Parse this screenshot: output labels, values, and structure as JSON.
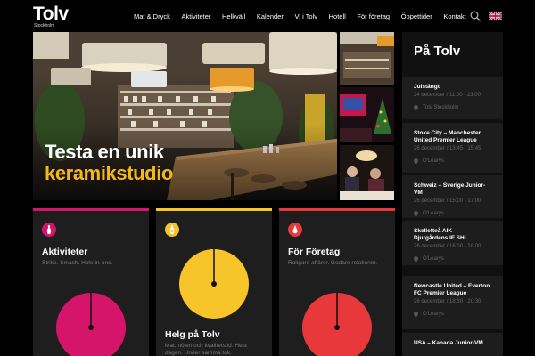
{
  "header": {
    "logo_text": "Tolv",
    "logo_subtext": "Stockholm",
    "nav": [
      "Mat & Dryck",
      "Aktiviteter",
      "Helkväll",
      "Kalender",
      "Vi i Tolv",
      "Hotell",
      "För företag",
      "Öppettider",
      "Kontakt"
    ]
  },
  "hero": {
    "headline_line1": "Testa en unik",
    "headline_line2": "keramikstudio",
    "accent_color": "#f2b71a"
  },
  "cards": [
    {
      "title": "Aktiviteter",
      "description": "Strike. Smash. Hole-in-one.",
      "color": "#d5156a",
      "icon": "bowling-pin-icon"
    },
    {
      "title": "Helg på Tolv",
      "description": "Mat, nöjen och kvalitetstid. Hela dagen. Under samma tak.",
      "color": "#f7c52a",
      "icon": "bottle-icon"
    },
    {
      "title": "För Företag",
      "description": "Roligare affärer. Godare relationer.",
      "color": "#e8383b",
      "icon": "drop-icon"
    }
  ],
  "sidebar": {
    "title": "På Tolv",
    "events": [
      {
        "title": "Julstängt",
        "date": "24 december / 11:00 - 23:00",
        "location": "Tolv Stockholm"
      },
      {
        "title": "Stoke City – Manchester United Premier League",
        "date": "26 december / 13:45 - 15:45",
        "location": "O'Learys"
      },
      {
        "title": "Schweiz – Sverige Junior-VM",
        "date": "26 december / 15:00 - 17:00",
        "location": "O'Learys"
      },
      {
        "title": "Skellefteå AIK – Djurgårdens IF SHL",
        "date": "26 december / 16:00 - 18:00",
        "location": "O'Learys"
      },
      {
        "title": "Newcastle United – Everton FC Premier League",
        "date": "26 december / 18:30 - 20:30",
        "location": "O'Learys"
      },
      {
        "title": "USA – Kanada Junior-VM",
        "date": "",
        "location": ""
      }
    ]
  }
}
